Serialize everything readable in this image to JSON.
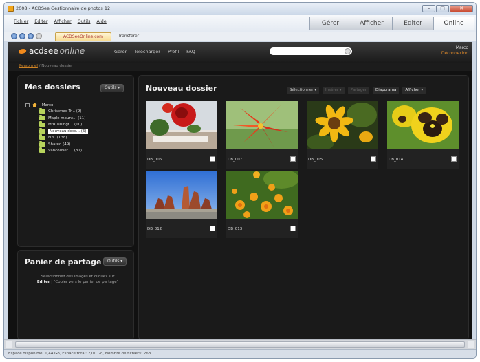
{
  "window": {
    "title": "2008 - ACDSee Gestionnaire de photos 12",
    "min": "–",
    "max": "□",
    "close": "✕"
  },
  "menu": [
    "Fichier",
    "Editer",
    "Afficher",
    "Outils",
    "Aide"
  ],
  "modes": [
    "Gérer",
    "Afficher",
    "Editer",
    "Online"
  ],
  "nav_tabs": {
    "site": "ACDSeeOnline.com",
    "transfer": "Transférer"
  },
  "app": {
    "logo_main": "acdsee",
    "logo_sub": "online",
    "nav": [
      "Gérer",
      "Télécharger",
      "Profil",
      "FAQ"
    ],
    "user": "_Marco",
    "logout": "Déconnexion"
  },
  "breadcrumb": {
    "root": "Personnel",
    "separator": "/",
    "current": "Nouveau dossier"
  },
  "folders_panel": {
    "title": "Mes dossiers",
    "tools_button": "Outils",
    "toggle": "−",
    "root": "_Marco",
    "items": [
      "Christmas Tr... (9)",
      "Maple mount... (11)",
      "MtRushingt... (10)",
      "Nouveau doss... (6)",
      "NYC (138)",
      "Shared (49)",
      "Vancouver ... (31)"
    ],
    "selected_index": 3
  },
  "share_panel": {
    "title": "Panier de partage",
    "tools_button": "Outils",
    "text_1": "Sélectionnez des images et cliquez sur",
    "text_bold": "Editer",
    "text_2": "| \"Copier vers le panier de partage\""
  },
  "content": {
    "title": "Nouveau dossier",
    "toolbar": {
      "select": "Sélectionner",
      "shuffle": "Insérer",
      "share": "Partager",
      "slideshow": "Diaporama",
      "view": "Afficher"
    },
    "photos": [
      {
        "name": "DB_006"
      },
      {
        "name": "DB_007"
      },
      {
        "name": "DB_005"
      },
      {
        "name": "DB_014"
      },
      {
        "name": "DB_012"
      },
      {
        "name": "DB_013"
      }
    ]
  },
  "status": "Espace disponible: 1,44 Go, Espace total: 2,00 Go, Nombre de fichiers: 268"
}
